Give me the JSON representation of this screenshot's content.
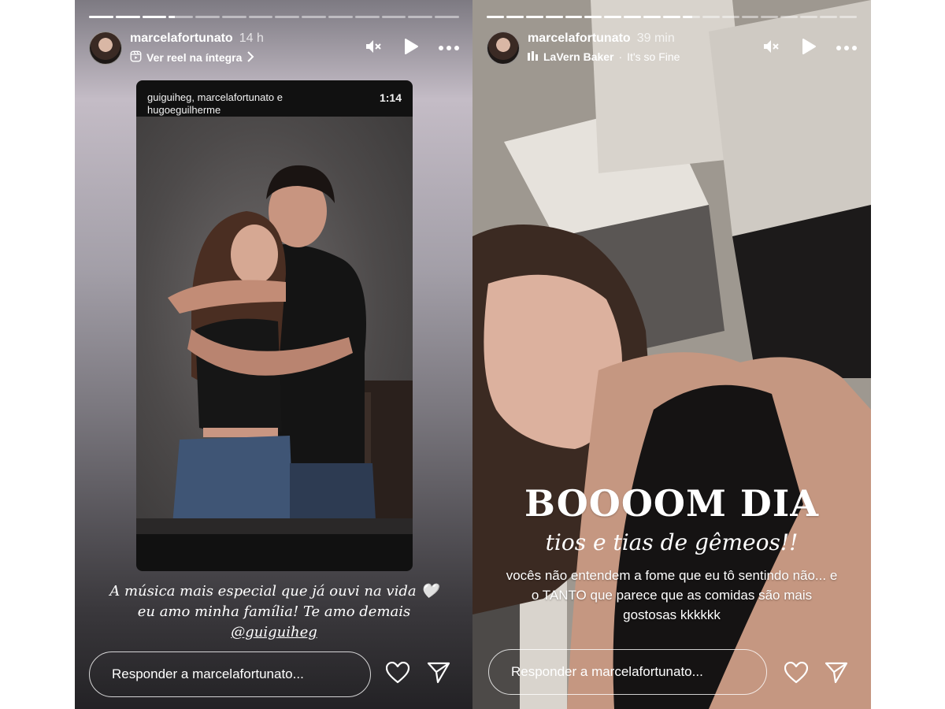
{
  "stories": [
    {
      "progress": [
        1,
        1,
        1,
        0.25,
        0,
        0,
        0,
        0,
        0,
        0,
        0,
        0,
        0,
        0
      ],
      "username": "marcelafortunato",
      "time": "14 h",
      "subtitle": "Ver reel na íntegra",
      "reel": {
        "names": "guiguiheg, marcelafortunato e hugoeguilherme",
        "duration": "1:14"
      },
      "caption_text": "A música mais especial que já ouvi na vida 🤍 eu amo minha família! Te amo demais ",
      "caption_mention": "@guiguiheg",
      "reply_placeholder": "Responder a marcelafortunato..."
    },
    {
      "progress": [
        1,
        1,
        1,
        1,
        1,
        1,
        1,
        1,
        1,
        1,
        0.55,
        0,
        0,
        0,
        0,
        0,
        0,
        0,
        0
      ],
      "username": "marcelafortunato",
      "time": "39 min",
      "music_artist": "LaVern Baker",
      "music_separator": "·",
      "music_song": "It's so Fine",
      "title": "BOOOOM DIA",
      "subtitle": "tios e tias de gêmeos!!",
      "caption": "vocês não entendem a fome que eu tô sentindo não... e o TANTO que parece que as comidas são mais gostosas kkkkkk",
      "reply_placeholder": "Responder a marcelafortunato..."
    }
  ],
  "icons": {
    "mute": "speaker-muted-icon",
    "play": "play-icon",
    "more": "more-horizontal-icon",
    "like": "heart-icon",
    "share": "send-icon",
    "reel": "reel-icon",
    "chevron": "chevron-right-icon",
    "music": "music-bars-icon"
  }
}
